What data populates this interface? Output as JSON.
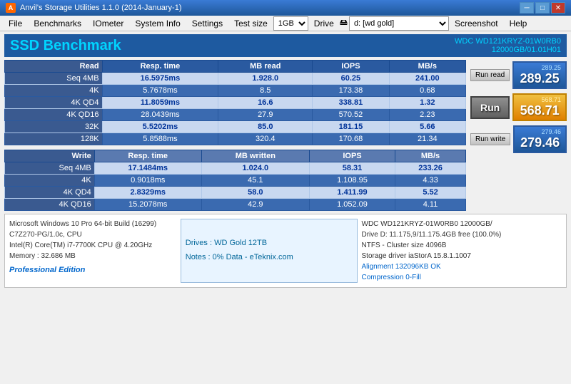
{
  "titleBar": {
    "icon": "A",
    "title": "Anvil's Storage Utilities 1.1.0 (2014-January-1)",
    "minimize": "─",
    "maximize": "□",
    "close": "✕"
  },
  "menuBar": {
    "items": [
      "File",
      "Benchmarks",
      "IOmeter",
      "System Info",
      "Settings",
      "Test size",
      "Drive",
      "Screenshot",
      "Help"
    ],
    "testSize": "1GB",
    "driveName": "d: [wd gold]"
  },
  "header": {
    "title": "SSD Benchmark",
    "driveModel": "WDC WD121KRYZ-01W0RB0",
    "driveInfo": "12000GB/01.01H01"
  },
  "readTable": {
    "headers": [
      "Read",
      "Resp. time",
      "MB read",
      "IOPS",
      "MB/s"
    ],
    "rows": [
      [
        "Seq 4MB",
        "16.5975ms",
        "1.928.0",
        "60.25",
        "241.00"
      ],
      [
        "4K",
        "5.7678ms",
        "8.5",
        "173.38",
        "0.68"
      ],
      [
        "4K QD4",
        "11.8059ms",
        "16.6",
        "338.81",
        "1.32"
      ],
      [
        "4K QD16",
        "28.0439ms",
        "27.9",
        "570.52",
        "2.23"
      ],
      [
        "32K",
        "5.5202ms",
        "85.0",
        "181.15",
        "5.66"
      ],
      [
        "128K",
        "5.8588ms",
        "320.4",
        "170.68",
        "21.34"
      ]
    ]
  },
  "writeTable": {
    "headers": [
      "Write",
      "Resp. time",
      "MB written",
      "IOPS",
      "MB/s"
    ],
    "rows": [
      [
        "Seq 4MB",
        "17.1484ms",
        "1.024.0",
        "58.31",
        "233.26"
      ],
      [
        "4K",
        "0.9018ms",
        "45.1",
        "1.108.95",
        "4.33"
      ],
      [
        "4K QD4",
        "2.8329ms",
        "58.0",
        "1.411.99",
        "5.52"
      ],
      [
        "4K QD16",
        "15.2078ms",
        "42.9",
        "1.052.09",
        "4.11"
      ]
    ]
  },
  "scores": {
    "readScore": "289.25",
    "readSmall": "289.25",
    "totalScore": "568.71",
    "totalSmall": "568.71",
    "writeScore": "279.46",
    "writeSmall": "279.46"
  },
  "buttons": {
    "runRead": "Run read",
    "run": "Run",
    "runWrite": "Run write"
  },
  "bottomLeft": {
    "os": "Microsoft Windows 10 Pro 64-bit Build (16299)",
    "cpu1": "C7Z270-PG/1.0c, CPU",
    "cpu2": "Intel(R) Core(TM) i7-7700K CPU @ 4.20GHz",
    "memory": "Memory : 32.686 MB",
    "edition": "Professional Edition"
  },
  "bottomCenter": {
    "drives": "Drives : WD Gold 12TB",
    "notes": "Notes : 0% Data - eTeknix.com"
  },
  "bottomRight": {
    "model": "WDC WD121KRYZ-01W0RB0 12000GB/",
    "drive": "Drive D: 11.175,9/11.175.4GB free (100.0%)",
    "fs": "NTFS - Cluster size 4096B",
    "driver": "Storage driver  iaStorA 15.8.1.1007",
    "alignment": "Alignment 132096KB OK",
    "compression": "Compression 0-Fill"
  }
}
